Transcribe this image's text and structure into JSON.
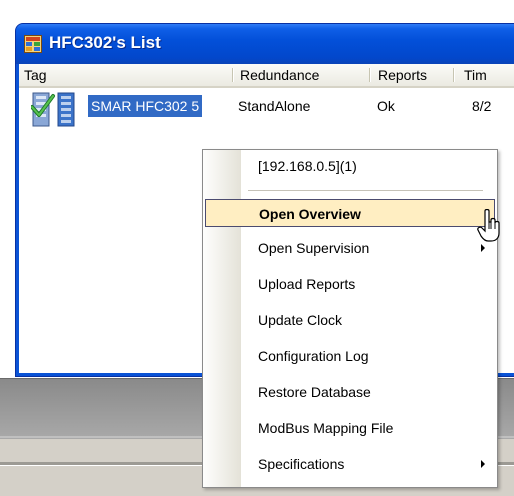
{
  "window": {
    "title": "HFC302's List"
  },
  "list": {
    "columns": [
      "Tag",
      "Redundance",
      "Reports",
      "Tim"
    ],
    "rows": [
      {
        "tag": "SMAR HFC302 5",
        "redundance": "StandAlone",
        "reports": "Ok",
        "time": "8/2"
      }
    ]
  },
  "context_menu": {
    "header": "[192.168.0.5](1)",
    "items": [
      {
        "label": "Open Overview",
        "highlighted": true,
        "submenu": false
      },
      {
        "label": "Open Supervision",
        "highlighted": false,
        "submenu": true
      },
      {
        "label": "Upload Reports",
        "highlighted": false,
        "submenu": false
      },
      {
        "label": "Update Clock",
        "highlighted": false,
        "submenu": false
      },
      {
        "label": "Configuration Log",
        "highlighted": false,
        "submenu": false
      },
      {
        "label": "Restore Database",
        "highlighted": false,
        "submenu": false
      },
      {
        "label": "ModBus Mapping File",
        "highlighted": false,
        "submenu": false
      },
      {
        "label": "Specifications",
        "highlighted": false,
        "submenu": true
      }
    ]
  },
  "icons": {
    "app": "app-window-icon",
    "row": "device-check-icon",
    "cursor": "mouse-pointer-icon"
  },
  "colors": {
    "titlebar": "#0350d9",
    "selection": "#316ac5",
    "menu_highlight": "#ffeec2"
  }
}
